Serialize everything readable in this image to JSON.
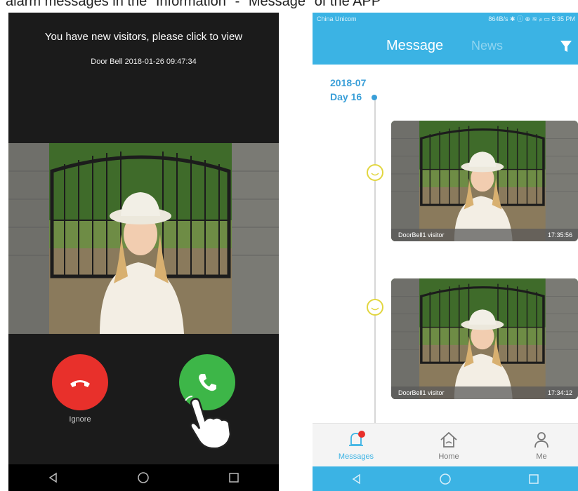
{
  "caption": "alarm messages in the \"Information\" - \"Message\" of the APP",
  "left_phone": {
    "notification_title": "You have new visitors, please click to view",
    "notification_subtitle": "Door Bell 2018-01-26 09:47:34",
    "ignore_label": "Ignore"
  },
  "right_phone": {
    "status": {
      "carrier": "China Unicom",
      "right": "864B/s ✱ ⓘ ⊕ ≋ ᵢₗₗ ▭ 5:35 PM"
    },
    "tabs": {
      "message": "Message",
      "news": "News"
    },
    "timeline": {
      "month": "2018-07",
      "day": "Day 16"
    },
    "cards": [
      {
        "label": "DoorBell1 visitor",
        "time": "17:35:56"
      },
      {
        "label": "DoorBell1 visitor",
        "time": "17:34:12"
      }
    ],
    "bottom_nav": [
      {
        "label": "Messages",
        "active": true
      },
      {
        "label": "Home",
        "active": false
      },
      {
        "label": "Me",
        "active": false
      }
    ]
  },
  "colors": {
    "accent": "#3bb3e4",
    "ignore": "#e8302b",
    "answer": "#3db648",
    "badge": "#e8302b"
  }
}
